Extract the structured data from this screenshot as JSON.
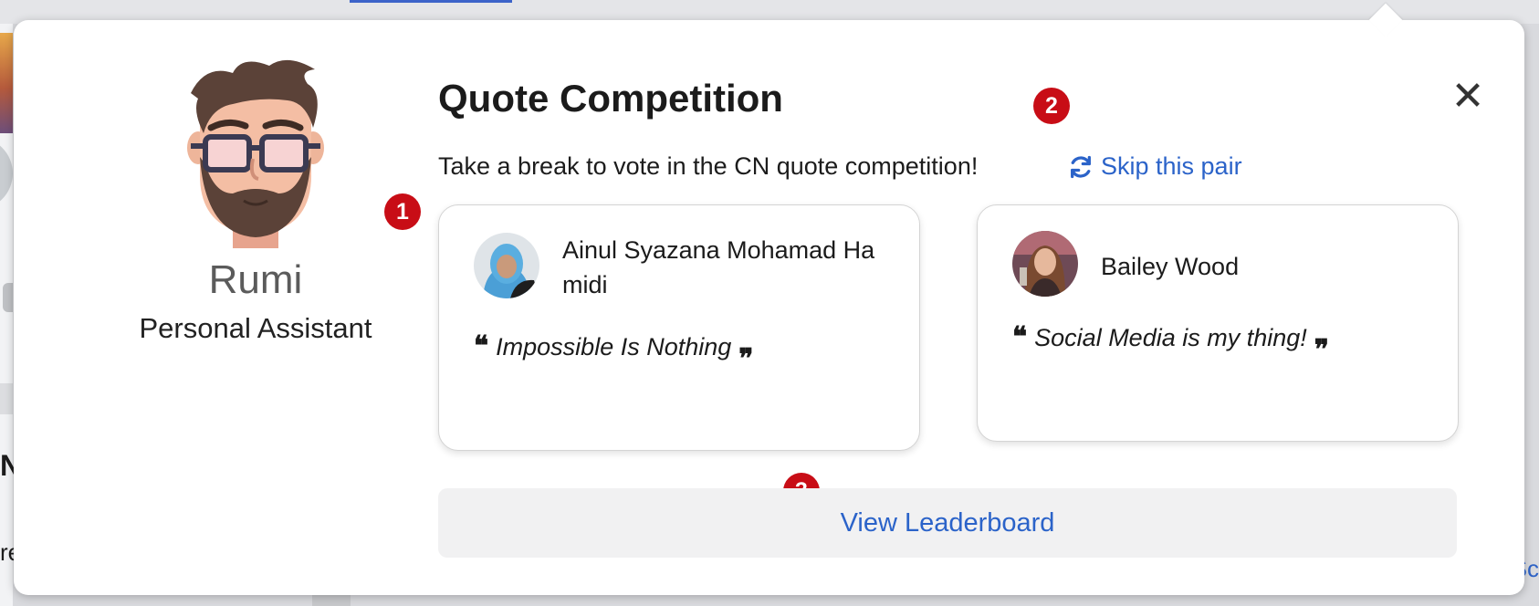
{
  "popup": {
    "title": "Quote Competition",
    "subtitle": "Take a break to vote in the CN quote competition!",
    "skip_label": "Skip this pair",
    "leaderboard_label": "View Leaderboard",
    "close_label": "✕"
  },
  "assistant": {
    "name": "Rumi",
    "role": "Personal Assistant"
  },
  "cards": [
    {
      "name": "Ainul Syazana Mohamad Hamidi",
      "quote": "Impossible Is Nothing"
    },
    {
      "name": "Bailey Wood",
      "quote": "Social Media is my thing!"
    }
  ],
  "markers": [
    "1",
    "2",
    "3"
  ],
  "quote_marks": {
    "open": "❝",
    "close": "❞"
  },
  "background": {
    "fragment_left_1": "N",
    "fragment_left_2": "re",
    "fragment_right": "Sc"
  },
  "colors": {
    "accent": "#2b63c9",
    "marker": "#c80d16"
  },
  "icons": {
    "close": "close-icon",
    "skip": "refresh-icon",
    "assistant": "assistant-avatar"
  }
}
